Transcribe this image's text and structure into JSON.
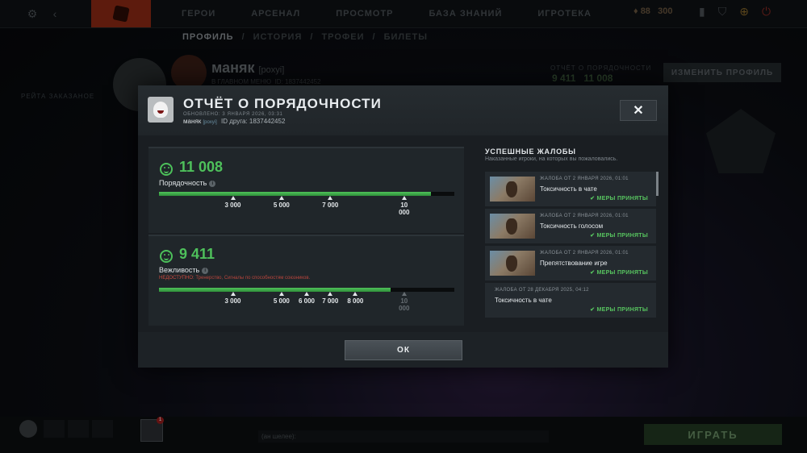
{
  "topbar": {
    "nav": [
      "ГЕРОИ",
      "АРСЕНАЛ",
      "ПРОСМОТР",
      "БАЗА ЗНАНИЙ",
      "ИГРОТЕКА"
    ],
    "shards_left": "88",
    "shards_right": "300"
  },
  "profile_bg": {
    "subnav": [
      "ПРОФИЛЬ",
      "ИСТОРИЯ",
      "ТРОФЕИ",
      "БИЛЕТЫ"
    ],
    "name": "маняк",
    "tag": "[poxyi]",
    "status": "В ГЛАВНОМ МЕНЮ",
    "id": "ID: 1837442452",
    "left_label": "РЕЙТА ЗАКАЗАНОЕ",
    "conduct_label": "ОТЧЁТ О ПОРЯДОЧНОСТИ",
    "conduct_a": "9 411",
    "conduct_b": "11 008",
    "edit_button": "ИЗМЕНИТЬ ПРОФИЛЬ"
  },
  "bottombar": {
    "party_count": "1",
    "chat_prefix": "(ан шелее):",
    "play_button": "ИГРАТЬ"
  },
  "modal": {
    "title": "ОТЧЁТ О ПОРЯДОЧНОСТИ",
    "updated": "ОБНОВЛЕНО: 3 ЯНВАРЯ 2026, 03:31",
    "username": "маняк",
    "usertag": "[poxyi]",
    "friend_id": "ID друга: 1837442452",
    "close_label": "✕",
    "behavior": {
      "value": "11 008",
      "label": "Порядочность",
      "fill_fraction": 0.92,
      "ticks": [
        {
          "label": "3 000",
          "pos": 0.25
        },
        {
          "label": "5 000",
          "pos": 0.415
        },
        {
          "label": "7 000",
          "pos": 0.58
        },
        {
          "label": "10\n000",
          "pos": 0.83
        }
      ]
    },
    "communication": {
      "value": "9 411",
      "label": "Вежливость",
      "unavailable_label": "НЕДОСТУПНО:",
      "unavailable_text": "Тренерство, Сигналы по способностям союзников.",
      "fill_fraction": 0.785,
      "ticks": [
        {
          "label": "3 000",
          "pos": 0.25
        },
        {
          "label": "5 000",
          "pos": 0.415
        },
        {
          "label": "6 000",
          "pos": 0.5
        },
        {
          "label": "7 000",
          "pos": 0.58
        },
        {
          "label": "8 000",
          "pos": 0.665
        },
        {
          "label": "10\n000",
          "pos": 0.83,
          "dim": true
        }
      ]
    },
    "reports": {
      "title": "УСПЕШНЫЕ ЖАЛОБЫ",
      "subtitle": "Наказанные игроки, на которых вы пожаловались.",
      "items": [
        {
          "date": "ЖАЛОБА ОТ 2 ЯНВАРЯ 2026, 01:01",
          "reason": "Токсичность в чате",
          "status": "МЕРЫ ПРИНЯТЫ",
          "hero": true
        },
        {
          "date": "ЖАЛОБА ОТ 2 ЯНВАРЯ 2026, 01:01",
          "reason": "Токсичность голосом",
          "status": "МЕРЫ ПРИНЯТЫ",
          "hero": true
        },
        {
          "date": "ЖАЛОБА ОТ 2 ЯНВАРЯ 2026, 01:01",
          "reason": "Препятствование игре",
          "status": "МЕРЫ ПРИНЯТЫ",
          "hero": true
        },
        {
          "date": "ЖАЛОБА ОТ 28 ДЕКАБРЯ 2025, 04:12",
          "reason": "Токсичность в чате",
          "status": "МЕРЫ ПРИНЯТЫ",
          "hero": false
        }
      ]
    },
    "ok_button": "ОК"
  },
  "colors": {
    "accent_green": "#4ec05b",
    "warning_red": "#c9493f",
    "modal_bg": "#1d2226"
  }
}
